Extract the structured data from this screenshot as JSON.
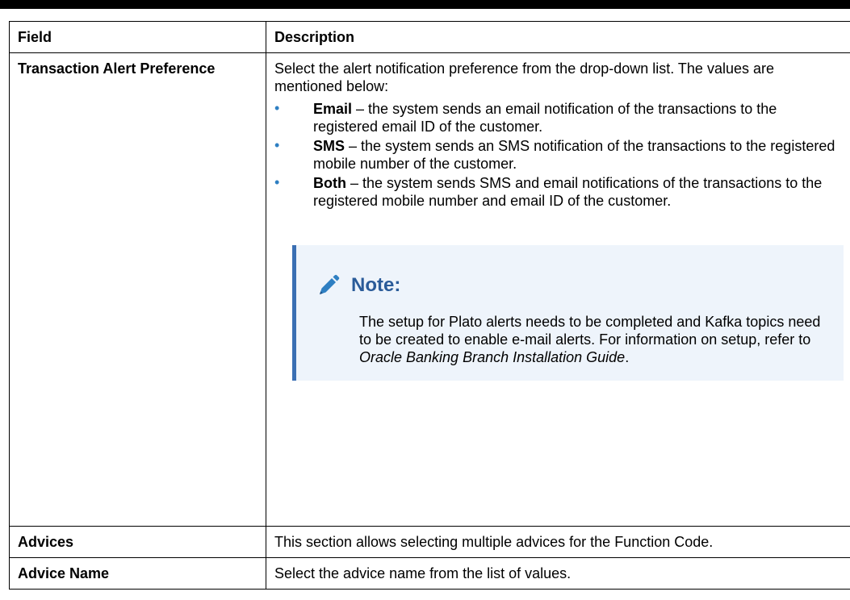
{
  "table": {
    "header": {
      "field": "Field",
      "description": "Description"
    },
    "row_alert": {
      "field": "Transaction Alert Preference",
      "intro": "Select the alert notification preference from the drop-down list. The values are mentioned below:",
      "values": [
        {
          "term": "Email",
          "text": " – the system sends an email notification of the transactions to the registered email ID of the customer."
        },
        {
          "term": "SMS",
          "text": " – the system sends an SMS notification of the transactions to the registered mobile number of the customer."
        },
        {
          "term": "Both",
          "text": " – the system sends SMS and email notifications of the transactions to the registered mobile number and email ID of the customer."
        }
      ],
      "note": {
        "icon": "pencil-icon",
        "title": "Note:",
        "body_prefix": "The setup for Plato alerts needs to be completed and Kafka topics need to be created to enable e-mail alerts. For information on setup, refer to ",
        "body_ref": "Oracle Banking Branch Installation Guide",
        "body_suffix": "."
      }
    },
    "row_advices": {
      "field": "Advices",
      "description": "This section allows selecting multiple advices for the Function Code."
    },
    "row_advice_name": {
      "field": "Advice Name",
      "description": "Select the advice name from the list of values."
    }
  },
  "colors": {
    "bullet": "#2e7fc2",
    "note_accent": "#3a6fb3",
    "note_title": "#2a5b99",
    "note_background": "#eef4fb"
  }
}
